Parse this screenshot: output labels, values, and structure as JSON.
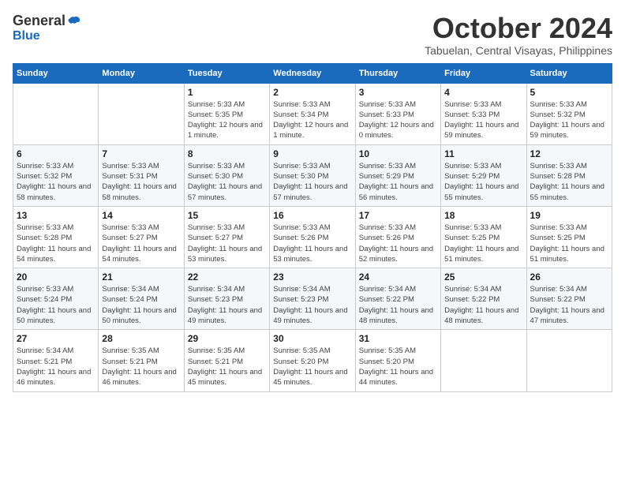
{
  "header": {
    "logo": {
      "general": "General",
      "blue": "Blue"
    },
    "title": "October 2024",
    "location": "Tabuelan, Central Visayas, Philippines"
  },
  "weekdays": [
    "Sunday",
    "Monday",
    "Tuesday",
    "Wednesday",
    "Thursday",
    "Friday",
    "Saturday"
  ],
  "weeks": [
    [
      {
        "day": "",
        "info": ""
      },
      {
        "day": "",
        "info": ""
      },
      {
        "day": "1",
        "info": "Sunrise: 5:33 AM\nSunset: 5:35 PM\nDaylight: 12 hours and 1 minute."
      },
      {
        "day": "2",
        "info": "Sunrise: 5:33 AM\nSunset: 5:34 PM\nDaylight: 12 hours and 1 minute."
      },
      {
        "day": "3",
        "info": "Sunrise: 5:33 AM\nSunset: 5:33 PM\nDaylight: 12 hours and 0 minutes."
      },
      {
        "day": "4",
        "info": "Sunrise: 5:33 AM\nSunset: 5:33 PM\nDaylight: 11 hours and 59 minutes."
      },
      {
        "day": "5",
        "info": "Sunrise: 5:33 AM\nSunset: 5:32 PM\nDaylight: 11 hours and 59 minutes."
      }
    ],
    [
      {
        "day": "6",
        "info": "Sunrise: 5:33 AM\nSunset: 5:32 PM\nDaylight: 11 hours and 58 minutes."
      },
      {
        "day": "7",
        "info": "Sunrise: 5:33 AM\nSunset: 5:31 PM\nDaylight: 11 hours and 58 minutes."
      },
      {
        "day": "8",
        "info": "Sunrise: 5:33 AM\nSunset: 5:30 PM\nDaylight: 11 hours and 57 minutes."
      },
      {
        "day": "9",
        "info": "Sunrise: 5:33 AM\nSunset: 5:30 PM\nDaylight: 11 hours and 57 minutes."
      },
      {
        "day": "10",
        "info": "Sunrise: 5:33 AM\nSunset: 5:29 PM\nDaylight: 11 hours and 56 minutes."
      },
      {
        "day": "11",
        "info": "Sunrise: 5:33 AM\nSunset: 5:29 PM\nDaylight: 11 hours and 55 minutes."
      },
      {
        "day": "12",
        "info": "Sunrise: 5:33 AM\nSunset: 5:28 PM\nDaylight: 11 hours and 55 minutes."
      }
    ],
    [
      {
        "day": "13",
        "info": "Sunrise: 5:33 AM\nSunset: 5:28 PM\nDaylight: 11 hours and 54 minutes."
      },
      {
        "day": "14",
        "info": "Sunrise: 5:33 AM\nSunset: 5:27 PM\nDaylight: 11 hours and 54 minutes."
      },
      {
        "day": "15",
        "info": "Sunrise: 5:33 AM\nSunset: 5:27 PM\nDaylight: 11 hours and 53 minutes."
      },
      {
        "day": "16",
        "info": "Sunrise: 5:33 AM\nSunset: 5:26 PM\nDaylight: 11 hours and 53 minutes."
      },
      {
        "day": "17",
        "info": "Sunrise: 5:33 AM\nSunset: 5:26 PM\nDaylight: 11 hours and 52 minutes."
      },
      {
        "day": "18",
        "info": "Sunrise: 5:33 AM\nSunset: 5:25 PM\nDaylight: 11 hours and 51 minutes."
      },
      {
        "day": "19",
        "info": "Sunrise: 5:33 AM\nSunset: 5:25 PM\nDaylight: 11 hours and 51 minutes."
      }
    ],
    [
      {
        "day": "20",
        "info": "Sunrise: 5:33 AM\nSunset: 5:24 PM\nDaylight: 11 hours and 50 minutes."
      },
      {
        "day": "21",
        "info": "Sunrise: 5:34 AM\nSunset: 5:24 PM\nDaylight: 11 hours and 50 minutes."
      },
      {
        "day": "22",
        "info": "Sunrise: 5:34 AM\nSunset: 5:23 PM\nDaylight: 11 hours and 49 minutes."
      },
      {
        "day": "23",
        "info": "Sunrise: 5:34 AM\nSunset: 5:23 PM\nDaylight: 11 hours and 49 minutes."
      },
      {
        "day": "24",
        "info": "Sunrise: 5:34 AM\nSunset: 5:22 PM\nDaylight: 11 hours and 48 minutes."
      },
      {
        "day": "25",
        "info": "Sunrise: 5:34 AM\nSunset: 5:22 PM\nDaylight: 11 hours and 48 minutes."
      },
      {
        "day": "26",
        "info": "Sunrise: 5:34 AM\nSunset: 5:22 PM\nDaylight: 11 hours and 47 minutes."
      }
    ],
    [
      {
        "day": "27",
        "info": "Sunrise: 5:34 AM\nSunset: 5:21 PM\nDaylight: 11 hours and 46 minutes."
      },
      {
        "day": "28",
        "info": "Sunrise: 5:35 AM\nSunset: 5:21 PM\nDaylight: 11 hours and 46 minutes."
      },
      {
        "day": "29",
        "info": "Sunrise: 5:35 AM\nSunset: 5:21 PM\nDaylight: 11 hours and 45 minutes."
      },
      {
        "day": "30",
        "info": "Sunrise: 5:35 AM\nSunset: 5:20 PM\nDaylight: 11 hours and 45 minutes."
      },
      {
        "day": "31",
        "info": "Sunrise: 5:35 AM\nSunset: 5:20 PM\nDaylight: 11 hours and 44 minutes."
      },
      {
        "day": "",
        "info": ""
      },
      {
        "day": "",
        "info": ""
      }
    ]
  ]
}
